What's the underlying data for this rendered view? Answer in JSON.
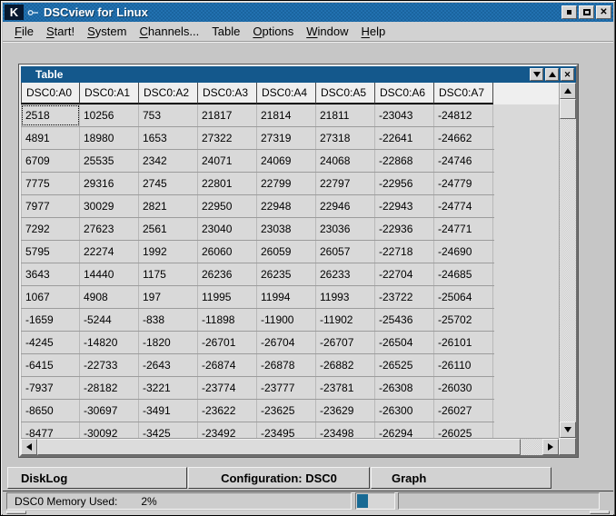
{
  "window": {
    "title": "DSCview for Linux",
    "logo_letter": "K"
  },
  "menu": {
    "items": [
      {
        "label": "File",
        "accel_index": 0
      },
      {
        "label": "Start!",
        "accel_index": 0
      },
      {
        "label": "System",
        "accel_index": 0
      },
      {
        "label": "Channels...",
        "accel_index": 0
      },
      {
        "label": "Table",
        "accel_index": -1
      },
      {
        "label": "Options",
        "accel_index": 0
      },
      {
        "label": "Window",
        "accel_index": 0
      },
      {
        "label": "Help",
        "accel_index": 0
      }
    ]
  },
  "table_window": {
    "title": "Table",
    "columns": [
      "DSC0:A0",
      "DSC0:A1",
      "DSC0:A2",
      "DSC0:A3",
      "DSC0:A4",
      "DSC0:A5",
      "DSC0:A6",
      "DSC0:A7"
    ],
    "rows": [
      [
        "2518",
        "10256",
        "753",
        "21817",
        "21814",
        "21811",
        "-23043",
        "-24812"
      ],
      [
        "4891",
        "18980",
        "1653",
        "27322",
        "27319",
        "27318",
        "-22641",
        "-24662"
      ],
      [
        "6709",
        "25535",
        "2342",
        "24071",
        "24069",
        "24068",
        "-22868",
        "-24746"
      ],
      [
        "7775",
        "29316",
        "2745",
        "22801",
        "22799",
        "22797",
        "-22956",
        "-24779"
      ],
      [
        "7977",
        "30029",
        "2821",
        "22950",
        "22948",
        "22946",
        "-22943",
        "-24774"
      ],
      [
        "7292",
        "27623",
        "2561",
        "23040",
        "23038",
        "23036",
        "-22936",
        "-24771"
      ],
      [
        "5795",
        "22274",
        "1992",
        "26060",
        "26059",
        "26057",
        "-22718",
        "-24690"
      ],
      [
        "3643",
        "14440",
        "1175",
        "26236",
        "26235",
        "26233",
        "-22704",
        "-24685"
      ],
      [
        "1067",
        "4908",
        "197",
        "11995",
        "11994",
        "11993",
        "-23722",
        "-25064"
      ],
      [
        "-1659",
        "-5244",
        "-838",
        "-11898",
        "-11900",
        "-11902",
        "-25436",
        "-25702"
      ],
      [
        "-4245",
        "-14820",
        "-1820",
        "-26701",
        "-26704",
        "-26707",
        "-26504",
        "-26101"
      ],
      [
        "-6415",
        "-22733",
        "-2643",
        "-26874",
        "-26878",
        "-26882",
        "-26525",
        "-26110"
      ],
      [
        "-7937",
        "-28182",
        "-3221",
        "-23774",
        "-23777",
        "-23781",
        "-26308",
        "-26030"
      ],
      [
        "-8650",
        "-30697",
        "-3491",
        "-23622",
        "-23625",
        "-23629",
        "-26300",
        "-26027"
      ],
      [
        "-8477",
        "-30092",
        "-3425",
        "-23492",
        "-23495",
        "-23498",
        "-26294",
        "-26025"
      ]
    ]
  },
  "tabs": {
    "items": [
      "DiskLog",
      "Configuration: DSC0",
      "Graph"
    ]
  },
  "statusbar": {
    "label": "DSC0 Memory Used:",
    "value": "2%",
    "progress_percent": 2
  },
  "icons": {
    "close": "✕",
    "minimize": "filled-square",
    "maximize": "outline-square",
    "shade_down": "triangle-down",
    "shade_up": "triangle-up",
    "scroll_up": "triangle-up",
    "scroll_down": "triangle-down",
    "scroll_left": "triangle-left",
    "scroll_right": "triangle-right",
    "kde_sticky_pin": "pushpin"
  },
  "colors": {
    "titlebar_blue": "#1e6ba6",
    "titlebar_blue_dark": "#15598f",
    "child_titlebar_blue": "#14588c",
    "progress_fill": "#186a94",
    "window_gray": "#c6c6c6",
    "table_bg": "#d9d9d9",
    "header_bg": "#efefef"
  }
}
